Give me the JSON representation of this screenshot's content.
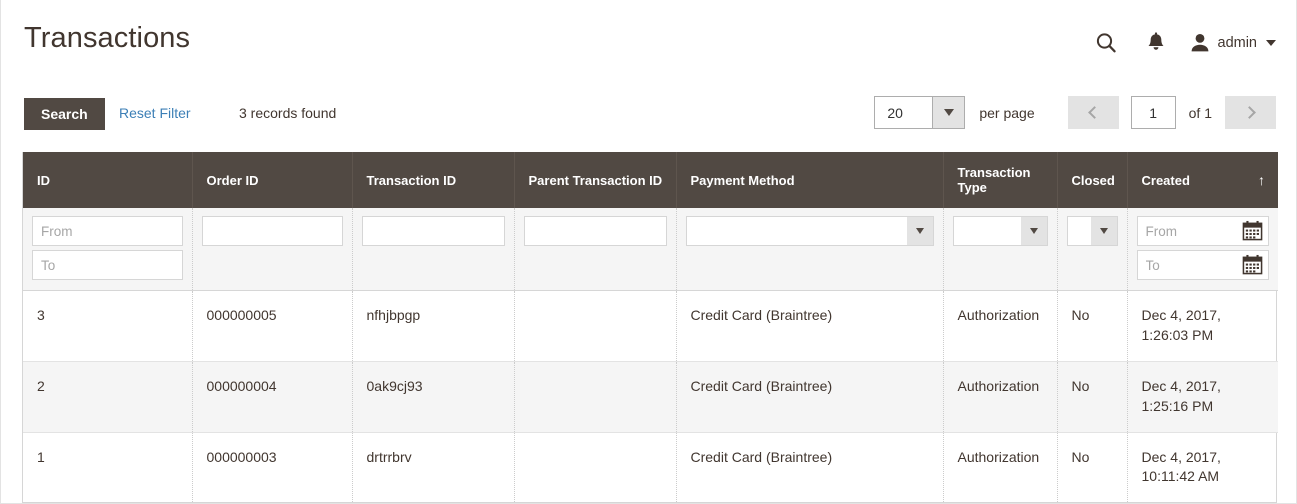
{
  "header": {
    "title": "Transactions",
    "search_icon": "search-icon",
    "notification_icon": "bell-icon",
    "avatar_icon": "user-icon",
    "admin_label": "admin",
    "caret_icon": "chevron-down-icon"
  },
  "toolbar": {
    "search_label": "Search",
    "reset_filter_label": "Reset Filter",
    "records_found": "3 records found",
    "per_page_value": "20",
    "per_page_label": "per page",
    "prev_icon": "chevron-left-icon",
    "next_icon": "chevron-right-icon",
    "page_value": "1",
    "of_label": "of 1"
  },
  "grid": {
    "columns": [
      {
        "label": "ID",
        "sort": ""
      },
      {
        "label": "Order ID",
        "sort": ""
      },
      {
        "label": "Transaction ID",
        "sort": ""
      },
      {
        "label": "Parent Transaction ID",
        "sort": ""
      },
      {
        "label": "Payment Method",
        "sort": ""
      },
      {
        "label": "Transaction Type",
        "sort": ""
      },
      {
        "label": "Closed",
        "sort": ""
      },
      {
        "label": "Created",
        "sort": "↑"
      }
    ],
    "filters": {
      "id_from_placeholder": "From",
      "id_to_placeholder": "To",
      "order_id_value": "",
      "transaction_id_value": "",
      "parent_transaction_id_value": "",
      "payment_method_value": "",
      "transaction_type_value": "",
      "closed_value": "",
      "created_from_placeholder": "From",
      "created_to_placeholder": "To",
      "calendar_icon": "calendar-icon"
    },
    "rows": [
      {
        "id": "3",
        "order_id": "000000005",
        "transaction_id": "nfhjbpgp",
        "parent_transaction_id": "",
        "payment_method": "Credit Card (Braintree)",
        "transaction_type": "Authorization",
        "closed": "No",
        "created": "Dec 4, 2017, 1:26:03 PM"
      },
      {
        "id": "2",
        "order_id": "000000004",
        "transaction_id": "0ak9cj93",
        "parent_transaction_id": "",
        "payment_method": "Credit Card (Braintree)",
        "transaction_type": "Authorization",
        "closed": "No",
        "created": "Dec 4, 2017, 1:25:16 PM"
      },
      {
        "id": "1",
        "order_id": "000000003",
        "transaction_id": "drtrrbrv",
        "parent_transaction_id": "",
        "payment_method": "Credit Card (Braintree)",
        "transaction_type": "Authorization",
        "closed": "No",
        "created": "Dec 4, 2017, 10:11:42 AM"
      }
    ]
  },
  "colors": {
    "header_bar": "#514943",
    "link": "#3c7fb6",
    "text": "#41362f",
    "row_alt": "#f5f5f5",
    "filter_bg": "#f5f5f5"
  }
}
